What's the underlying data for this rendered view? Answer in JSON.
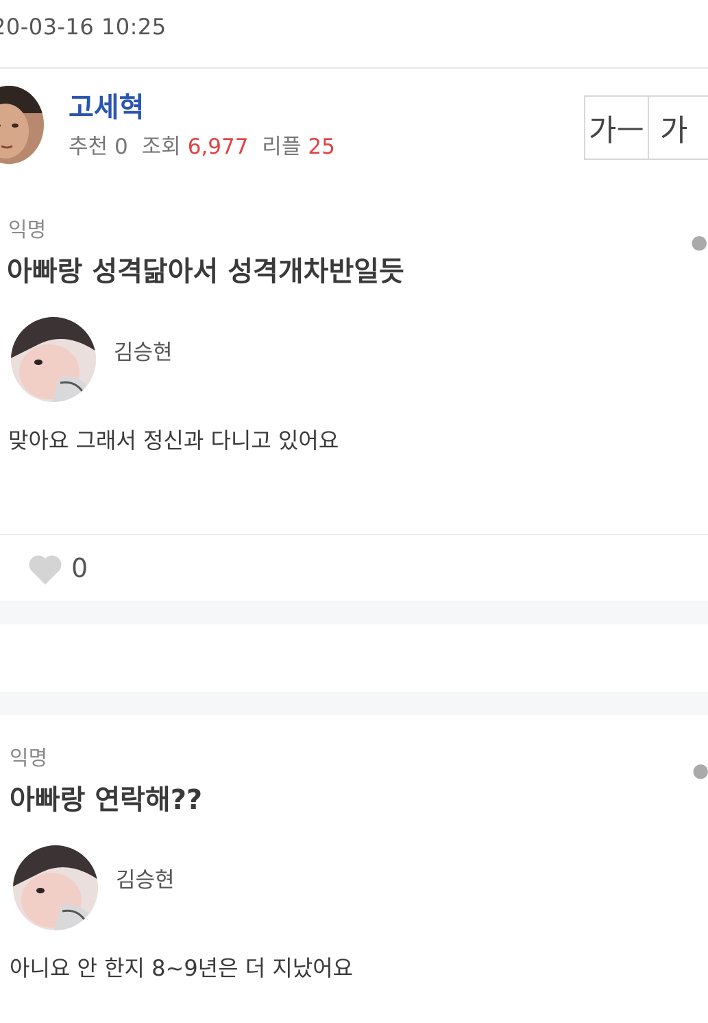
{
  "post": {
    "timestamp": "20-03-16 10:25",
    "author": "고세혁",
    "stats": {
      "recommend_label": "추천",
      "recommend_value": "0",
      "views_label": "조회",
      "views_value": "6,977",
      "replies_label": "리플",
      "replies_value": "25"
    }
  },
  "font_controls": {
    "smaller_label": "가ㅡ",
    "larger_label": "가"
  },
  "comments": [
    {
      "author": "익명",
      "text": "아빠랑 성격닮아서 성격개차반일듯",
      "more_icon": "more-dots-icon",
      "reply": {
        "author": "김승현",
        "text": "맞아요 그래서 정신과 다니고 있어요"
      },
      "likes": "0"
    },
    {
      "author": "익명",
      "text": "아빠랑 연락해??",
      "more_icon": "more-dots-icon",
      "reply": {
        "author": "김승현",
        "text": "아니요 안 한지 8~9년은 더 지났어요"
      }
    }
  ],
  "colors": {
    "author": "#2a55b0",
    "highlight": "#e04343",
    "like": "#d4d4d4"
  }
}
